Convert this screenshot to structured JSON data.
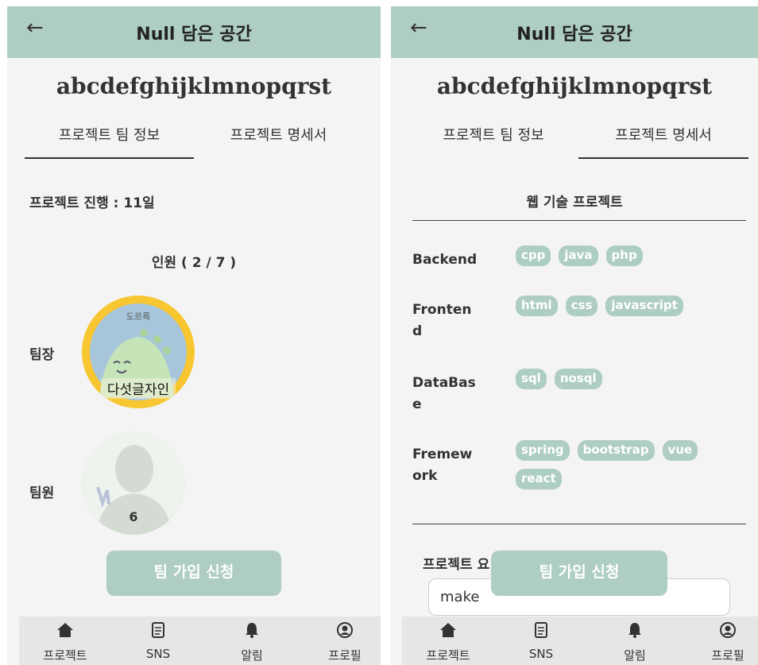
{
  "header": {
    "back_icon": "←",
    "title": "Null 담은 공간"
  },
  "project": {
    "name": "abcdefghijklmnopqrst"
  },
  "tabs": [
    {
      "label": "프로젝트 팀 정보"
    },
    {
      "label": "프로젝트 명세서"
    }
  ],
  "team_info": {
    "progress": "프로젝트 진행 : 11일",
    "members_count": "인원 ( 2 / 7 )",
    "leader_label": "팀장",
    "leader_avatar_tag": "도르륵",
    "leader_name": "다섯글자인",
    "member_label": "팀원",
    "member_name": "6"
  },
  "spec": {
    "section_title": "웹 기술 프로젝트",
    "tech": [
      {
        "name": "Backend",
        "items": [
          "cpp",
          "java",
          "php"
        ]
      },
      {
        "name": "Fronten\nd",
        "items": [
          "html",
          "css",
          "javascript"
        ]
      },
      {
        "name": "DataBas\ne",
        "items": [
          "sql",
          "nosql"
        ]
      },
      {
        "name": "Fremew\nork",
        "items": [
          "spring",
          "bootstrap",
          "vue",
          "react"
        ]
      }
    ],
    "description_label": "프로젝트 요",
    "description_value": "make"
  },
  "join_button": "팀 가입 신청",
  "nav": [
    {
      "label": "프로젝트",
      "icon": "home-icon"
    },
    {
      "label": "SNS",
      "icon": "document-icon"
    },
    {
      "label": "알림",
      "icon": "bell-icon"
    },
    {
      "label": "프로필",
      "icon": "profile-icon"
    }
  ],
  "colors": {
    "header": "#aecdc3",
    "leader_ring": "#f8c630",
    "badge": "#aecdc3"
  }
}
